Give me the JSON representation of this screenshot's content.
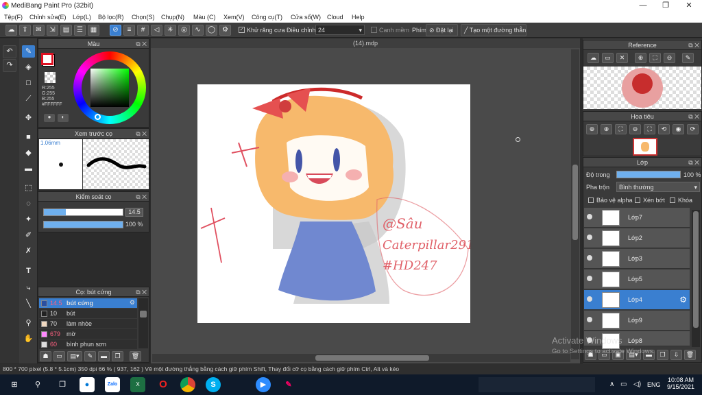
{
  "app": {
    "title": "MediBang Paint Pro (32bit)"
  },
  "menu": [
    "Tệp(F)",
    "Chỉnh sửa(E)",
    "Lớp(L)",
    "Bộ lọc(R)",
    "Chọn(S)",
    "Chụp(N)",
    "Màu (C)",
    "Xem(V)",
    "Công cụ(T)",
    "Cửa sổ(W)",
    "Cloud",
    "Help"
  ],
  "toolbar": {
    "antialias": "Khử răng cưa",
    "adjust_label": "Điều chỉnh",
    "adjust_value": "24",
    "snap": "Canh mềm",
    "key_label": "Phím",
    "reset": "Đặt lại",
    "create_line": "Tạo một đường thẳng"
  },
  "color_panel": {
    "title": "Màu",
    "r": "R:255",
    "g": "G:255",
    "b": "B:255",
    "hex": "#FFFFFF"
  },
  "preview_panel": {
    "title": "Xem trước cọ",
    "size": "1.06mm"
  },
  "control_panel": {
    "title": "Kiểm soát cọ",
    "size": "14.5",
    "opacity": "100 %"
  },
  "brush_panel": {
    "title": "Cọ: bút cứng",
    "items": [
      {
        "size": "14.5",
        "name": "bút cứng",
        "color": "#2a4fa0",
        "size_color": "#ff6080"
      },
      {
        "size": "10",
        "name": "bút",
        "color": "#222222",
        "size_color": "#dddddd"
      },
      {
        "size": "70",
        "name": "làm nhòe",
        "color": "#f0d8c0",
        "size_color": "#dddddd"
      },
      {
        "size": "679",
        "name": "mờ",
        "color": "#ff88ff",
        "size_color": "#ff6080"
      },
      {
        "size": "60",
        "name": "bình phun sơn",
        "color": "#dddddd",
        "size_color": "#ff6080"
      }
    ]
  },
  "document": {
    "tab": "(14).mdp"
  },
  "reference_panel": {
    "title": "Reference"
  },
  "navigator_panel": {
    "title": "Hoa tiêu"
  },
  "layer_panel": {
    "title": "Lớp",
    "opacity_label": "Độ trong",
    "opacity_value": "100 %",
    "blend_label": "Pha trộn",
    "blend_value": "Bình thường",
    "protect_alpha": "Bảo vệ alpha",
    "clipping": "Xén bớt",
    "lock": "Khóa",
    "layers": [
      "Lớp7",
      "Lớp2",
      "Lớp3",
      "Lớp5",
      "Lớp4",
      "Lớp9",
      "Lớp8"
    ],
    "selected": "Lớp4"
  },
  "status": {
    "text": "800 * 700 pixel  (5.8 * 5.1cm)  350 dpi  66 %  ( 937, 162 )  Vẽ một đường thẳng bằng cách giữ phím Shift, Thay đổi cỡ cọ bằng cách giữ phím Ctrl, Alt và kéo"
  },
  "watermark": {
    "line1": "Activate Windows",
    "line2": "Go to Settings to activate Windows."
  },
  "signature": "@Sâu Caterpillar2911 #HD247",
  "taskbar": {
    "time": "10:08 AM",
    "date": "9/15/2021",
    "lang": "ENG"
  }
}
